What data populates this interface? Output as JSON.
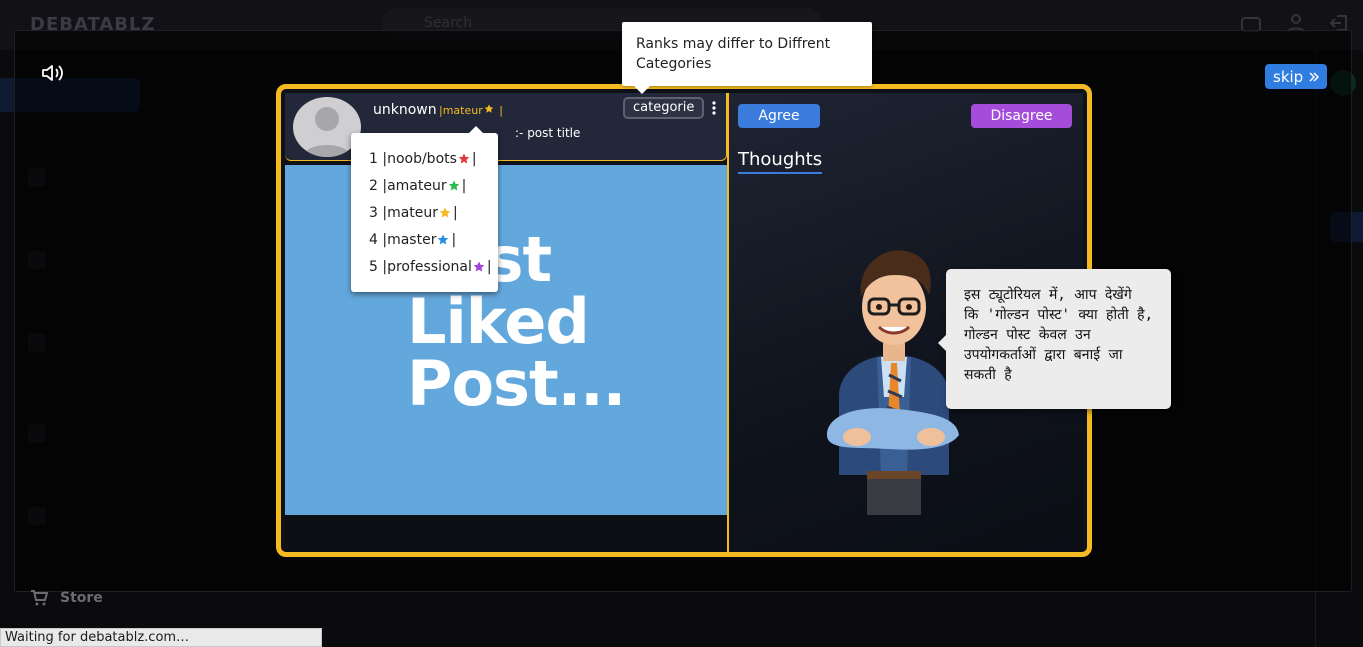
{
  "app": {
    "logo_text": "DEBATABLZ"
  },
  "search": {
    "placeholder": "Search"
  },
  "sidebar": {
    "store_label": "Store"
  },
  "status_bar": {
    "text": "Waiting for debatablz.com…"
  },
  "tutorial": {
    "skip_label": "skip",
    "tooltip_text": "Ranks may differ to Diffrent Categories",
    "speech_text": "इस ट्यूटोरियल में, आप देखेंगे कि 'गोल्डन पोस्ट' क्या होती है, गोल्डन पोस्ट केवल उन उपयोगकर्ताओं द्वारा बनाई जा सकती है"
  },
  "post": {
    "username": "unknown",
    "rank_label": "|mateur",
    "rank_suffix": " |",
    "title": ":- post title",
    "category_button": "categorie",
    "image_text_line1": "ost",
    "image_text_line2": "Liked",
    "image_text_line3": "Post..."
  },
  "rank_menu": {
    "items": [
      {
        "label": "1 |noob/bots",
        "star_color": "#e23b3b"
      },
      {
        "label": "2 |amateur",
        "star_color": "#2fb94a"
      },
      {
        "label": "3 |mateur",
        "star_color": "#f5b921"
      },
      {
        "label": "4 |master",
        "star_color": "#2a8fe0"
      },
      {
        "label": "5 |professional",
        "star_color": "#a442d8"
      }
    ],
    "separator": " |"
  },
  "thoughts": {
    "agree_label": "Agree",
    "disagree_label": "Disagree",
    "tab_label": "Thoughts"
  },
  "colors": {
    "accent_gold": "#f5b921",
    "agree_blue": "#3a7bdc",
    "disagree_purple": "#a54cdb",
    "skip_blue": "#2f7de1"
  }
}
